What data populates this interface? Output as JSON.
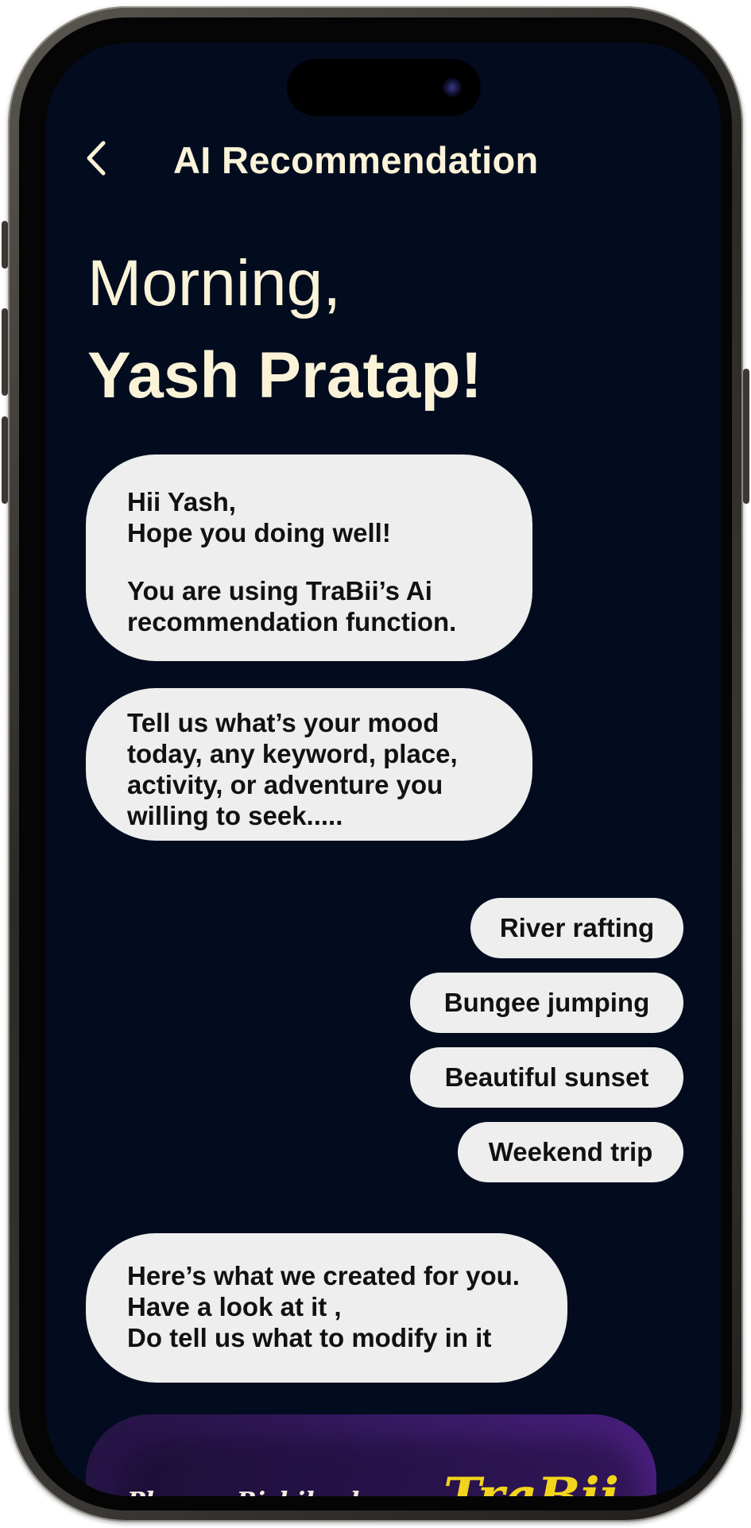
{
  "header": {
    "title": "AI Recommendation"
  },
  "greeting": {
    "line1": "Morning,",
    "line2": "Yash Pratap!"
  },
  "messages": [
    {
      "lines": [
        "Hii Yash,",
        "Hope you doing well!"
      ],
      "lines2": [
        "You are using TraBii’s Ai",
        "recommendation function."
      ]
    },
    {
      "lines": [
        "Tell us what’s your mood",
        "today, any keyword, place,",
        "activity, or adventure you",
        "willing to seek....."
      ]
    },
    {
      "lines": [
        "Here’s what we created for you.",
        "Have a look at it ,",
        "Do tell us what to modify in it"
      ]
    }
  ],
  "suggestions": [
    "River rafting",
    "Bungee jumping",
    "Beautiful sunset",
    "Weekend trip"
  ],
  "card": {
    "place_label": "Place :–  Rishikesh",
    "logo_text": "TraBii"
  },
  "colors": {
    "screen_background": "#030c1f",
    "header_text": "#fbf3d8",
    "bubble": "#eeeeee",
    "logo": "#f2d41c"
  }
}
